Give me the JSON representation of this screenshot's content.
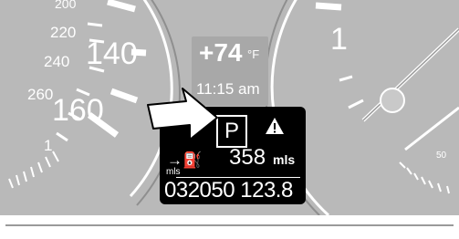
{
  "speedometer": {
    "labels": {
      "s200": "200",
      "s220": "220",
      "s240": "240",
      "s140": "140",
      "s260": "260",
      "s160": "160",
      "s1": "1"
    }
  },
  "tachometer": {
    "labels": {
      "minus1": "1",
      "fifty": "50"
    }
  },
  "info_display": {
    "temperature": "+74",
    "temperature_unit": "°F",
    "time": "11:15 am",
    "gear": "P",
    "range_value": "358",
    "range_unit": "mls",
    "distance_unit": "mls",
    "odometer": "032050 123.8",
    "warning_icon": "warning-triangle-icon",
    "range_icon": "fuel-range-icon"
  },
  "colors": {
    "cluster_background": "#b9b9b9",
    "display_background": "#000000",
    "label_color": "#ffffff"
  }
}
